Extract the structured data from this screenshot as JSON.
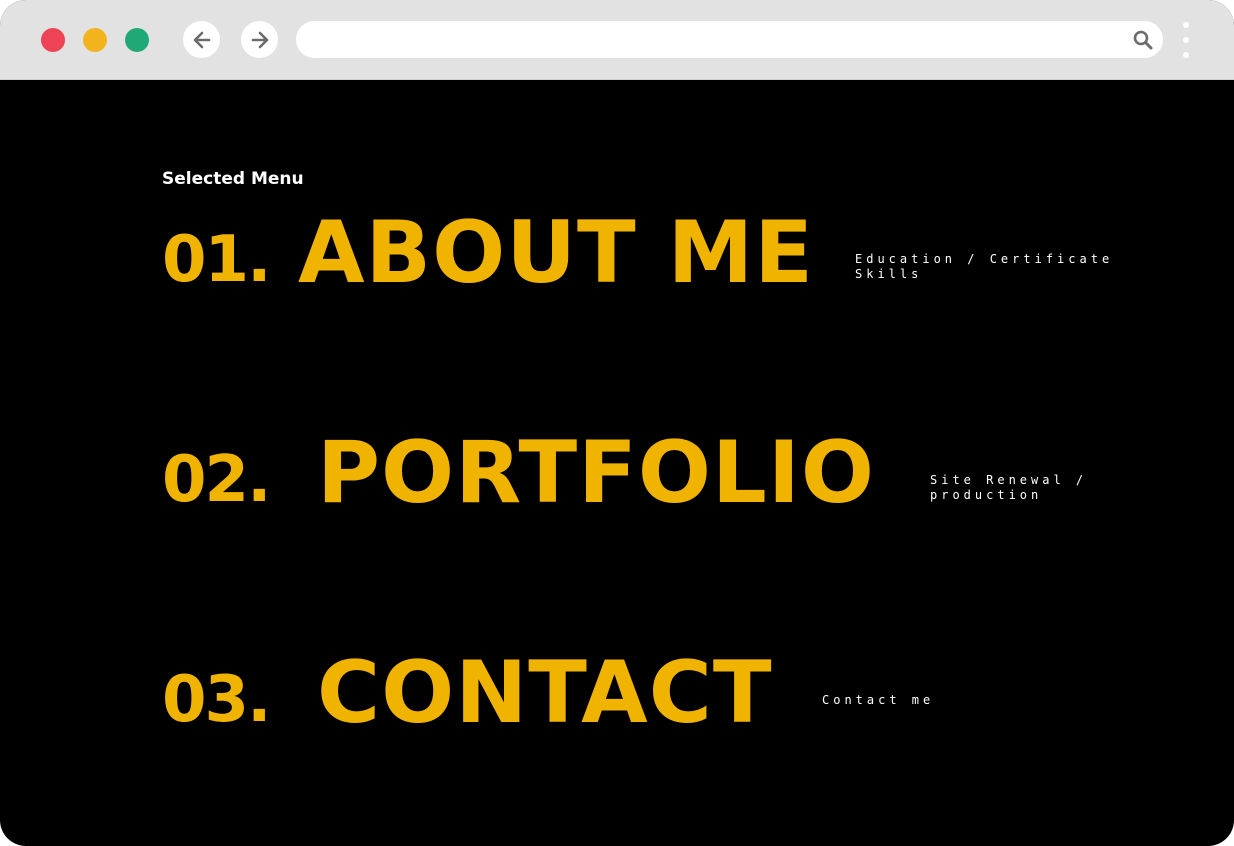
{
  "browser": {
    "traffic_lights": [
      "#ee4257",
      "#f2b31d",
      "#21a877"
    ],
    "back_icon": "arrow-left-icon",
    "forward_icon": "arrow-right-icon",
    "address_bar": {
      "value": "",
      "placeholder": ""
    },
    "search_icon": "search-icon",
    "menu_icon": "kebab-menu-icon"
  },
  "page": {
    "background": "#000000",
    "accent": "#efb300",
    "menu_title": "Selected Menu",
    "items": [
      {
        "number": "01.",
        "label": "ABOUT ME",
        "sub": "Education / Certificate\nSkills"
      },
      {
        "number": "02.",
        "label": "PORTFOLIO",
        "sub": "Site Renewal / production"
      },
      {
        "number": "03.",
        "label": "CONTACT",
        "sub": "Contact me"
      }
    ]
  }
}
